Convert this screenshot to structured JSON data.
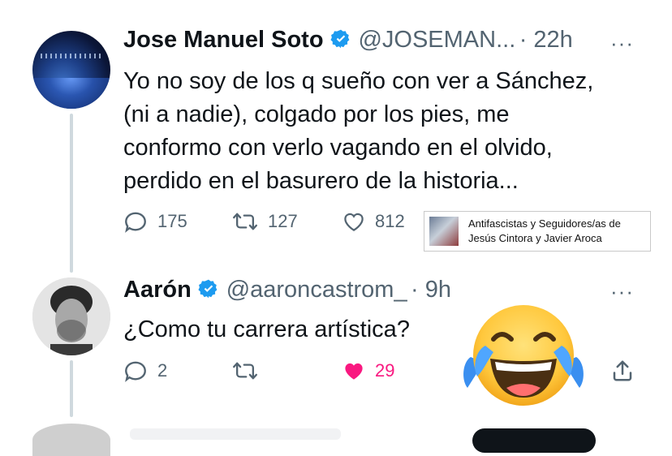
{
  "tweet1": {
    "name": "Jose Manuel Soto",
    "handle": "@JOSEMAN...",
    "time": "· 22h",
    "more": "···",
    "lines": [
      "Yo no soy de los q sueño con ver a Sánchez,",
      "(ni a nadie), colgado por los pies, me",
      "conformo con verlo vagando en el olvido,",
      "perdido en el basurero de la historia..."
    ],
    "replies": "175",
    "retweets": "127",
    "likes": "812"
  },
  "watermark": {
    "line1": "Antifascistas y Seguidores/as de",
    "line2": "Jesús Cintora y Javier Aroca"
  },
  "tweet2": {
    "name": "Aarón",
    "handle": "@aaroncastrom_",
    "time": "· 9h",
    "more": "···",
    "text": "¿Como tu carrera artística?",
    "replies": "2",
    "retweets": "",
    "likes": "29"
  },
  "colors": {
    "text": "#0f1419",
    "secondary": "#536471",
    "verified": "#1d9bf0",
    "liked": "#f91880"
  },
  "icons": [
    "verified-badge-icon",
    "reply-icon",
    "retweet-icon",
    "like-icon",
    "share-icon",
    "laughing-emoji-icon"
  ]
}
